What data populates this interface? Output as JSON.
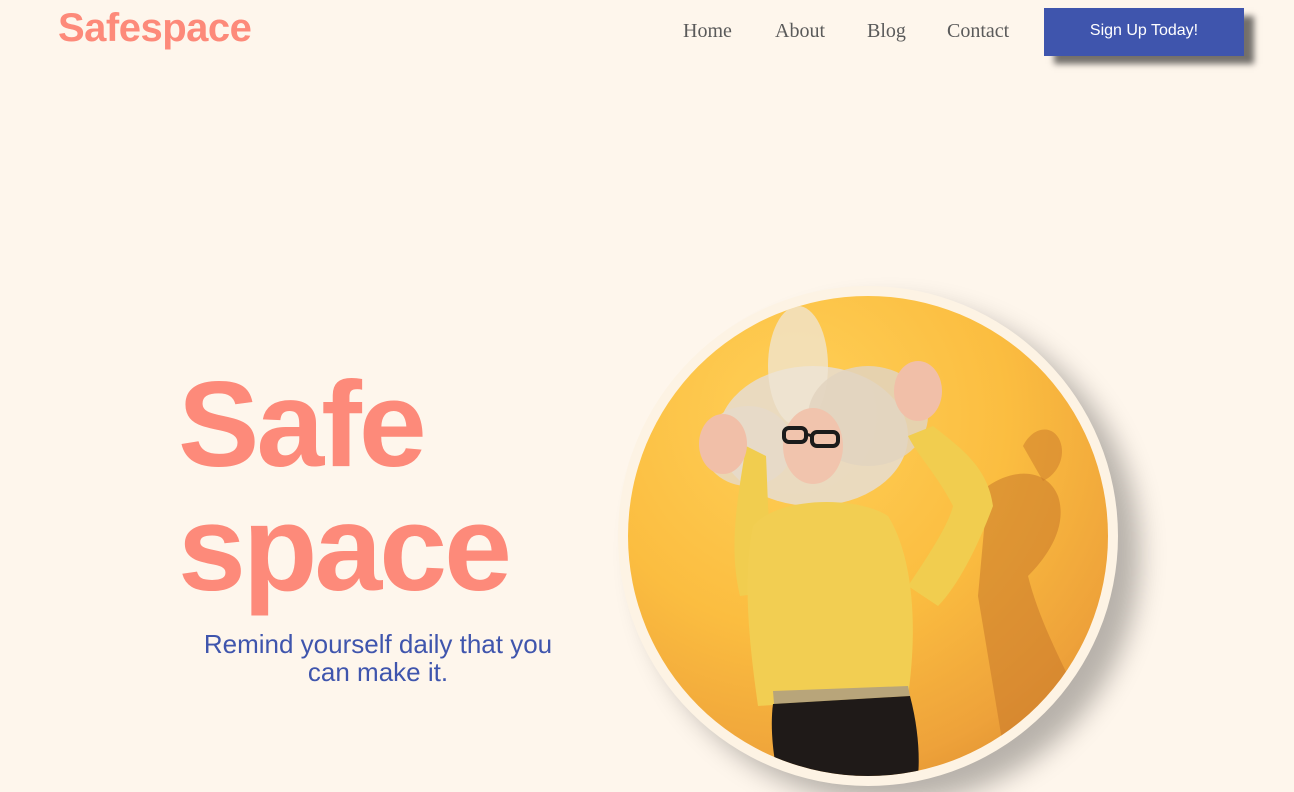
{
  "brand": {
    "logo_text": "Safespace"
  },
  "nav": {
    "items": [
      {
        "label": "Home"
      },
      {
        "label": "About"
      },
      {
        "label": "Blog"
      },
      {
        "label": "Contact"
      }
    ],
    "cta_label": "Sign Up Today!"
  },
  "hero": {
    "title_line1": "Safe",
    "title_line2": "space",
    "subtitle": "Remind yourself daily that you can make it."
  },
  "colors": {
    "background": "#fef6ec",
    "brand_coral": "#fd8a7a",
    "accent_blue": "#3f55ad",
    "nav_text": "#5a5a5a"
  }
}
